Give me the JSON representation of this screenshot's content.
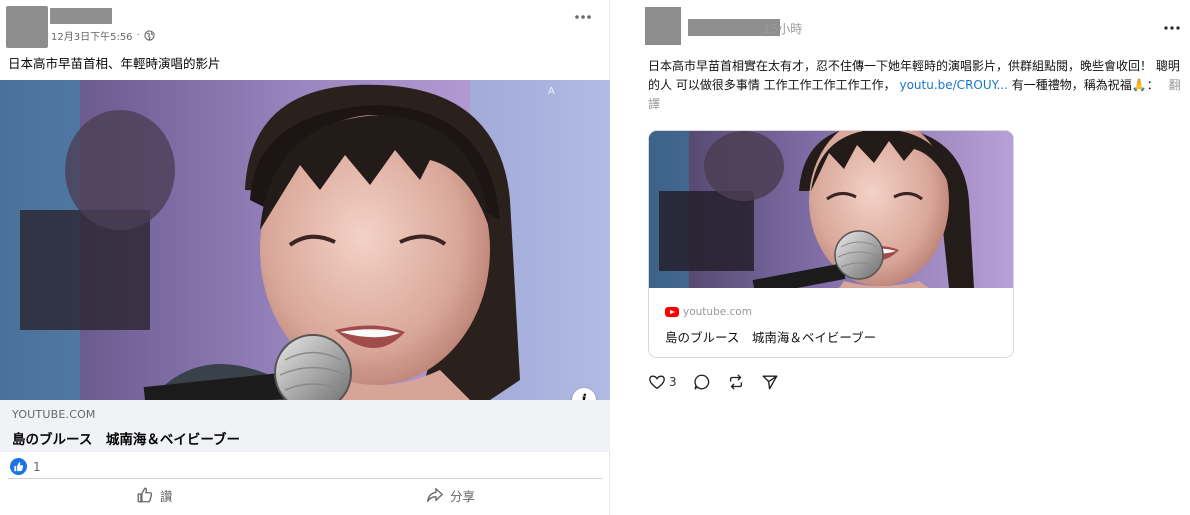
{
  "left_post": {
    "author_name": "",
    "timestamp": "12月3日下午5:56",
    "separator": "·",
    "text": "日本高市早苗首相、年輕時演唱的影片",
    "link_preview": {
      "domain": "YOUTUBE.COM",
      "title": "島のブルース　城南海＆ベイビーブー",
      "info_icon": "i"
    },
    "reactions": {
      "like_count": "1"
    },
    "actions": {
      "like_label": "讚",
      "share_label": "分享"
    }
  },
  "right_post": {
    "author_name": "",
    "time": "15小時",
    "text_main": "日本高市早苗首相實在太有才，忍不住傳一下她年輕時的演唱影片，供群組點閱，晚些會收回！ 聰明的人 可以做很多事情 工作工作工作工作工作，",
    "text_link": "youtu.be/CROUY...",
    "text_after": " 有一種禮物，稱為祝福",
    "emoji": "🙏",
    "text_tail": "：",
    "translate_label": "翻譯",
    "link_card": {
      "domain": "youtube.com",
      "title": "島のブルース　城南海＆ベイビーブー"
    },
    "actions": {
      "like_count": "3"
    }
  },
  "colors": {
    "facebook_blue": "#1b74e4",
    "link_blue": "#1877c9",
    "youtube_red": "#ff0000",
    "muted_gray": "#65676b"
  }
}
